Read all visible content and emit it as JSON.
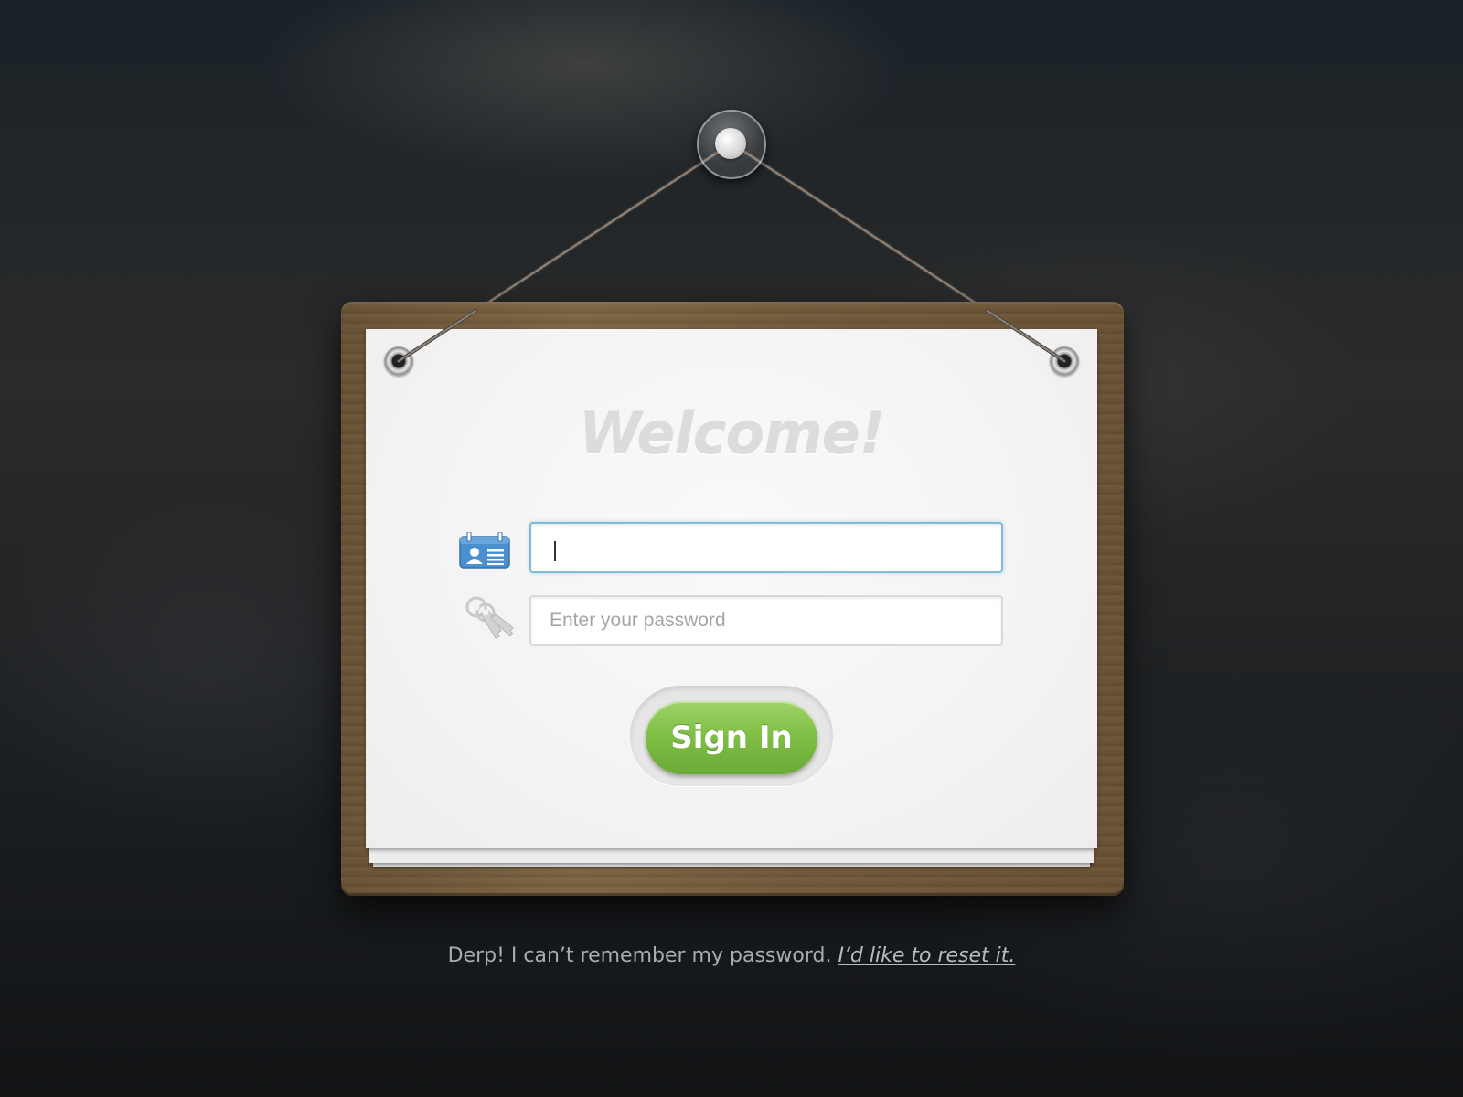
{
  "board": {
    "title": "Welcome!"
  },
  "login_form": {
    "username": {
      "value": "",
      "placeholder": "",
      "icon": "id-card-icon"
    },
    "password": {
      "value": "",
      "placeholder": "Enter your password",
      "icon": "keys-icon"
    },
    "sign_in_label": "Sign In"
  },
  "footer": {
    "forgot_text": "Derp! I can’t remember my password.",
    "reset_link": "I’d like to reset it."
  },
  "colors": {
    "accent_green": "#7fbf46",
    "focus_blue": "#7fbcd6",
    "icon_blue": "#4a8fd0",
    "wood": "#735b3c",
    "background": "#1f2326"
  }
}
